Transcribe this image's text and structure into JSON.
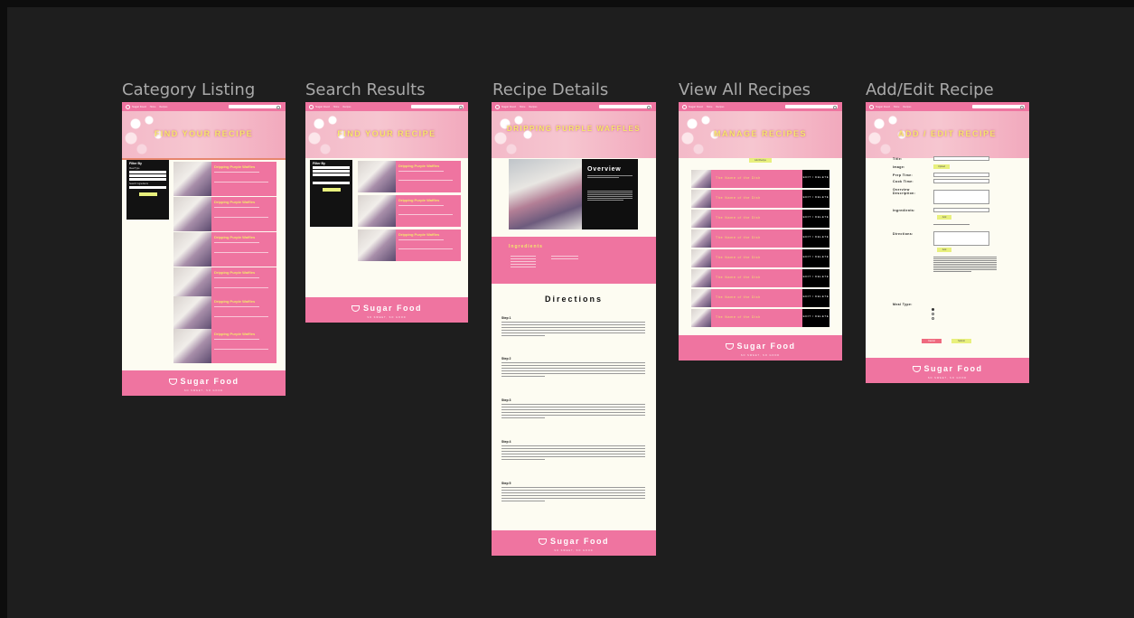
{
  "frames": [
    {
      "title": "Category Listing"
    },
    {
      "title": "Search Results"
    },
    {
      "title": "Recipe Details"
    },
    {
      "title": "View All Recipes"
    },
    {
      "title": "Add/Edit Recipe"
    }
  ],
  "nav": {
    "brand": "Sugar Food",
    "link_home": "Home",
    "link_recipes": "Recipes"
  },
  "footer": {
    "brand": "Sugar Food",
    "tagline": "SO SWEET, SO GOOD"
  },
  "category": {
    "hero": "FIND YOUR RECIPE",
    "filter_title": "Filter By",
    "filter_label_meal": "Meal Type",
    "filter_label_ingredient": "Search Ingredients",
    "filter_button": "Submit",
    "card_title": "Dripping Purple Waffles"
  },
  "search": {
    "hero": "FIND YOUR RECIPE",
    "filter_title": "Filter By",
    "filter_button": "Submit",
    "card_title": "Dripping Purple Waffles"
  },
  "details": {
    "hero": "DRIPPING PURPLE WAFFLES",
    "overview": "Overview",
    "ingredients": "Ingredients",
    "directions": "Directions",
    "steps": [
      "Step 1",
      "Step 2",
      "Step 3",
      "Step 4",
      "Step 5"
    ]
  },
  "manage": {
    "hero": "MANAGE RECIPES",
    "add_button": "Add Recipe",
    "row_title": "The Name of the Dish",
    "edit_delete": "EDIT / DELETE"
  },
  "edit": {
    "hero": "ADD / EDIT RECIPE",
    "labels": {
      "title": "Title:",
      "image": "Image:",
      "prep": "Prep Time:",
      "cook": "Cook Time:",
      "overview": "Overview Description:",
      "ingredients": "Ingredients:",
      "directions": "Directions:",
      "meal": "Meal Type:"
    },
    "upload": "Upload",
    "add": "Add",
    "cancel": "Cancel",
    "submit": "Submit"
  }
}
